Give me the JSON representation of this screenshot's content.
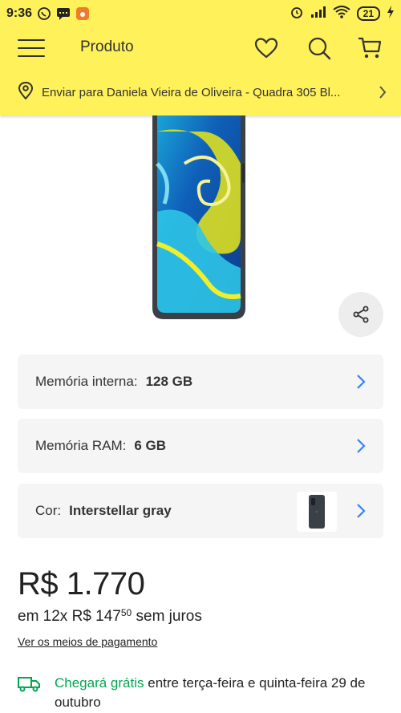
{
  "statusbar": {
    "time": "9:36",
    "battery": "21"
  },
  "header": {
    "title": "Produto"
  },
  "shipping": {
    "text": "Enviar para Daniela Vieira de Oliveira - Quadra 305 Bl..."
  },
  "variants": [
    {
      "label": "Memória interna:",
      "value": "128 GB"
    },
    {
      "label": "Memória RAM:",
      "value": "6 GB"
    },
    {
      "label": "Cor:",
      "value": "Interstellar gray"
    }
  ],
  "price": {
    "main": "R$ 1.770",
    "installment_prefix": "em 12x R$ 147",
    "installment_cents": "50",
    "installment_suffix": " sem juros",
    "payment_link": "Ver os meios de pagamento"
  },
  "delivery": {
    "prefix": "Chegará grátis",
    "rest": " entre terça-feira e quinta-feira 29 de outubro"
  },
  "colors": {
    "brand_yellow": "#fff159",
    "accent_blue": "#3483fa",
    "delivery_green": "#00a650"
  }
}
